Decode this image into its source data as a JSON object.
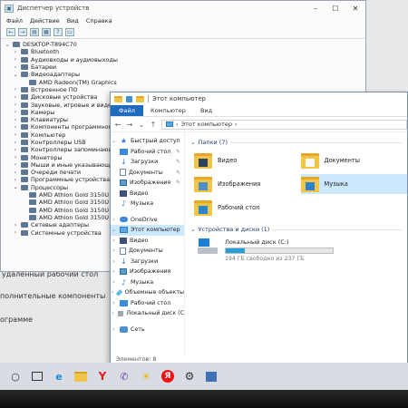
{
  "device_manager": {
    "title": "Диспетчер устройств",
    "menu": [
      "Файл",
      "Действие",
      "Вид",
      "Справка"
    ],
    "nodes": [
      {
        "label": "DESKTOP-T894C70",
        "level": 0,
        "expanded": true
      },
      {
        "label": "Bluetooth",
        "level": 1
      },
      {
        "label": "Аудиовходы и аудиовыходы",
        "level": 1
      },
      {
        "label": "Батареи",
        "level": 1
      },
      {
        "label": "Видеоадаптеры",
        "level": 1,
        "expanded": true
      },
      {
        "label": "AMD Radeon(TM) Graphics",
        "level": 2
      },
      {
        "label": "Встроенное ПО",
        "level": 1
      },
      {
        "label": "Дисковые устройства",
        "level": 1
      },
      {
        "label": "Звуковые, игровые и видеоу",
        "level": 1
      },
      {
        "label": "Камеры",
        "level": 1
      },
      {
        "label": "Клавиатуры",
        "level": 1
      },
      {
        "label": "Компоненты программного обе",
        "level": 1
      },
      {
        "label": "Компьютер",
        "level": 1
      },
      {
        "label": "Контроллеры USB",
        "level": 1
      },
      {
        "label": "Контроллеры запоминающих",
        "level": 1
      },
      {
        "label": "Мониторы",
        "level": 1
      },
      {
        "label": "Мыши и иные указывающие",
        "level": 1
      },
      {
        "label": "Очереди печати",
        "level": 1
      },
      {
        "label": "Программные устройства",
        "level": 1
      },
      {
        "label": "Процессоры",
        "level": 1,
        "expanded": true
      },
      {
        "label": "AMD Athlon Gold 3150U wit",
        "level": 2
      },
      {
        "label": "AMD Athlon Gold 3150U wit",
        "level": 2
      },
      {
        "label": "AMD Athlon Gold 3150U wit",
        "level": 2
      },
      {
        "label": "AMD Athlon Gold 3150U wit",
        "level": 2
      },
      {
        "label": "Сетевые адаптеры",
        "level": 1
      },
      {
        "label": "Системные устройства",
        "level": 1
      }
    ]
  },
  "background_text": {
    "line1": "удаленный рабочий стол",
    "line2": "полнительные компоненты",
    "line3": "ограмме"
  },
  "explorer": {
    "title": "Этот компьютер",
    "ribbon_tabs": [
      "Файл",
      "Компьютер",
      "Вид"
    ],
    "address_path": "Этот компьютер",
    "nav": [
      {
        "label": "Быстрый доступ",
        "icon": "star",
        "arrow": "v"
      },
      {
        "label": "Рабочий стол",
        "icon": "desk",
        "pinned": true
      },
      {
        "label": "Загрузки",
        "icon": "down",
        "pinned": true
      },
      {
        "label": "Документы",
        "icon": "doc",
        "pinned": true
      },
      {
        "label": "Изображения",
        "icon": "img",
        "pinned": true
      },
      {
        "label": "Видео",
        "icon": "vid"
      },
      {
        "label": "Музыка",
        "icon": "music"
      },
      {
        "label": "",
        "icon": "spacer"
      },
      {
        "label": "OneDrive",
        "icon": "cloud",
        "arrow": ">"
      },
      {
        "label": "Этот компьютер",
        "icon": "pc",
        "arrow": "v",
        "selected": true
      },
      {
        "label": "Видео",
        "icon": "vid",
        "arrow": ">"
      },
      {
        "label": "Документы",
        "icon": "doc",
        "arrow": ">"
      },
      {
        "label": "Загрузки",
        "icon": "down",
        "arrow": ">"
      },
      {
        "label": "Изображения",
        "icon": "img",
        "arrow": ">"
      },
      {
        "label": "Музыка",
        "icon": "music",
        "arrow": ">"
      },
      {
        "label": "Объемные объекты",
        "icon": "cube",
        "arrow": ">"
      },
      {
        "label": "Рабочий стол",
        "icon": "desk",
        "arrow": ">"
      },
      {
        "label": "Локальный диск (C",
        "icon": "drive",
        "arrow": ">"
      },
      {
        "label": "",
        "icon": "spacer"
      },
      {
        "label": "Сеть",
        "icon": "net",
        "arrow": ">"
      }
    ],
    "folders_header": "Папки (7)",
    "folders": [
      {
        "label": "Видео",
        "icon": "vid"
      },
      {
        "label": "Документы",
        "icon": "doc"
      },
      {
        "label": "Изображения",
        "icon": "img"
      },
      {
        "label": "Музыка",
        "icon": "music",
        "selected": true
      },
      {
        "label": "Рабочий стол",
        "icon": "desk"
      }
    ],
    "drives_header": "Устройства и диски (1)",
    "drive": {
      "label": "Локальный диск (C:)",
      "free_text": "194 ГБ свободно из 237 ГБ",
      "used_fraction": 0.18
    },
    "status": "Элементов: 8"
  },
  "taskbar": {
    "items": [
      "search",
      "task-view",
      "edge",
      "explorer",
      "yandex-browser",
      "viber",
      "beeline",
      "yandex",
      "settings",
      "flag"
    ]
  }
}
